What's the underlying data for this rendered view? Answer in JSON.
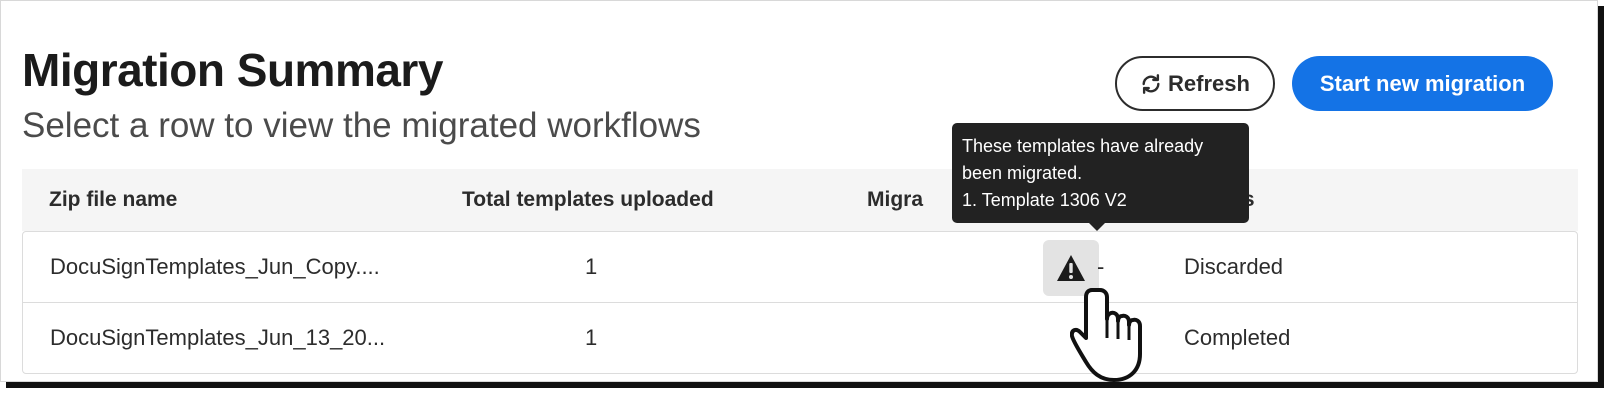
{
  "header": {
    "title": "Migration Summary",
    "subtitle": "Select a row to view the migrated workflows"
  },
  "actions": {
    "refresh_label": "Refresh",
    "start_label": "Start new migration"
  },
  "table": {
    "columns": [
      "Zip file name",
      "Total templates uploaded",
      "Migrated templates",
      "Status"
    ],
    "visible_column_fragments": {
      "migrated": "Migra",
      "status": "tus"
    },
    "rows": [
      {
        "zip_file_name": "DocuSignTemplates_Jun_Copy....",
        "total_uploaded": "1",
        "migrated": "-",
        "status": "Discarded"
      },
      {
        "zip_file_name": "DocuSignTemplates_Jun_13_20...",
        "total_uploaded": "1",
        "migrated": "",
        "status": "Completed"
      }
    ]
  },
  "tooltip": {
    "line1": "These templates have already",
    "line2": "been migrated.",
    "line3": "1. Template 1306 V2"
  },
  "colors": {
    "primary": "#1473e6",
    "tooltip_bg": "#222222"
  },
  "icons": {
    "refresh": "refresh-icon",
    "warning": "warning-icon",
    "cursor": "hand-pointer-icon"
  }
}
